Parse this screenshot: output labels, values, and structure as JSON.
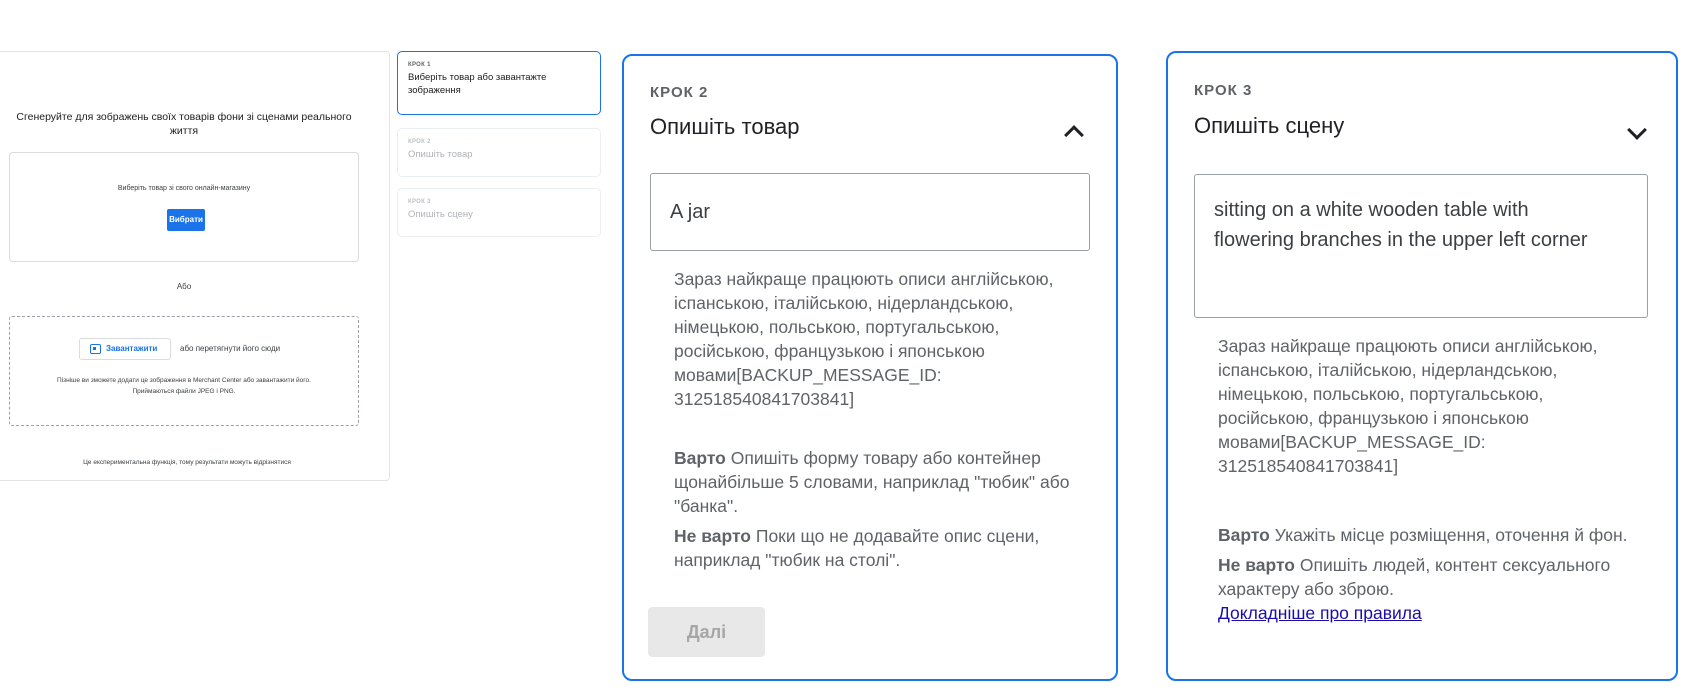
{
  "left_panel": {
    "title": "Сгенеруйте для зображень своїх товарів фони зі сценами реального життя",
    "select_text": "Виберіть товар зі свого онлайн-магазину",
    "select_button": "Вибрати",
    "or_text": "Або",
    "upload_button": "Завантажити",
    "drag_text": "або перетягнути його сюди",
    "upload_note_line1": "Пізніше ви зможете додати це зображення в Merchant Center або завантажити його.",
    "upload_note_line2": "Приймаються файли JPEG і PNG.",
    "footnote": "Це експериментальна функція, тому результати можуть відрізнятися"
  },
  "steps": [
    {
      "kicker": "КРОК 1",
      "label": "Виберіть товар або завантажте зображення"
    },
    {
      "kicker": "КРОК 2",
      "label": "Опишіть товар"
    },
    {
      "kicker": "КРОК 3",
      "label": "Опишіть сцену"
    }
  ],
  "step2_card": {
    "kicker": "КРОК 2",
    "title": "Опишіть товар",
    "input_value": "A jar",
    "hint": "Зараз найкраще працюють описи англійською, іспанською, італійською, нідерландською, німецькою, польською, португальською, російською, французькою і японською мовами[BACKUP_MESSAGE_ID: 312518540841703841]",
    "do_label": "Варто",
    "do_text": "Опишіть форму товару або контейнер щонайбільше 5 словами, наприклад \"тюбик\" або \"банка\".",
    "dont_label": "Не варто",
    "dont_text": "Поки що не додавайте опис сцени, наприклад \"тюбик на столі\".",
    "next_button": "Далі"
  },
  "step3_card": {
    "kicker": "КРОК 3",
    "title": "Опишіть сцену",
    "input_line1": "sitting on a white wooden table with",
    "input_line2": "flowering branches in the upper left corner",
    "hint": "Зараз найкраще працюють описи англійською, іспанською, італійською, нідерландською, німецькою, польською, португальською, російською, французькою і японською мовами[BACKUP_MESSAGE_ID: 312518540841703841]",
    "do_label": "Варто",
    "do_text": "Укажіть місце розміщення, оточення й фон.",
    "dont_label": "Не варто",
    "dont_text": "Опишіть людей, контент сексуального характеру або зброю.",
    "rules_link": "Докладніше про правила"
  },
  "colors": {
    "accent": "#1a73e8",
    "link": "#1a0dab",
    "text": "#3c4043",
    "muted": "#5f6368"
  },
  "icons": [
    "add-photo-icon",
    "chevron-up-icon",
    "chevron-down-icon"
  ]
}
